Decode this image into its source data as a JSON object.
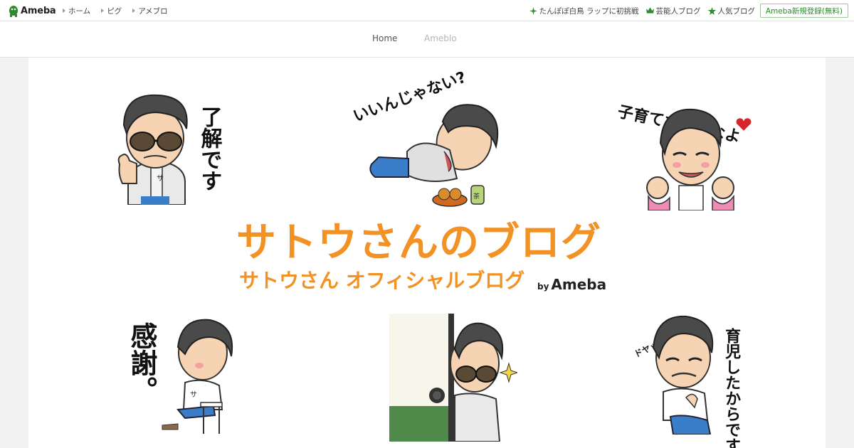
{
  "header": {
    "logo_text": "Ameba",
    "left_nav": [
      {
        "label": "ホーム"
      },
      {
        "label": "ピグ"
      },
      {
        "label": "アメブロ"
      }
    ],
    "right_nav": [
      {
        "label": "たんぽぽ白鳥 ラップに初挑戦",
        "icon": "sparkle-icon"
      },
      {
        "label": "芸能人ブログ",
        "icon": "crown-icon"
      },
      {
        "label": "人気ブログ",
        "icon": "star-icon"
      }
    ],
    "register_label": "Ameba新規登録(無料)"
  },
  "blog_nav": {
    "home": "Home",
    "ameblo": "Ameblo"
  },
  "banner": {
    "title": "サトウさんのブログ",
    "subtitle": "サトウさん オフィシャルブログ",
    "by": "by",
    "brand": "Ameba",
    "stickers": {
      "ryokai": "了解です",
      "iinjanai": "いいんじゃない?",
      "kosodate": "子育てなめんなよ",
      "kansha": "感謝。",
      "ikuji": "育児したからです",
      "doya": "ドヤッ"
    }
  },
  "colors": {
    "accent_orange": "#f29224",
    "brand_green": "#2d8a2d",
    "sticker_hair": "#4a4a4a",
    "sticker_skin": "#f6d3b3"
  }
}
